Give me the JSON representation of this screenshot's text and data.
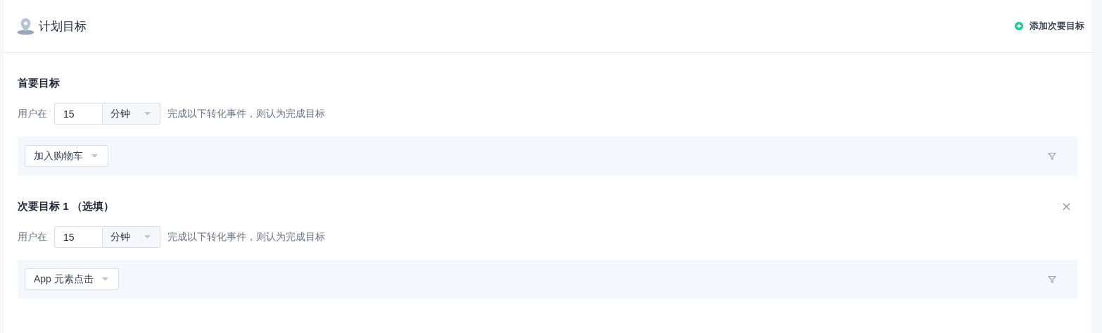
{
  "header": {
    "title": "计划目标",
    "add_button": "添加次要目标"
  },
  "goals": [
    {
      "title": "首要目标",
      "removable": false,
      "prefix": "用户在",
      "value": "15",
      "unit": "分钟",
      "suffix": "完成以下转化事件，则认为完成目标",
      "event": "加入购物车"
    },
    {
      "title": "次要目标 1 （选填）",
      "removable": true,
      "prefix": "用户在",
      "value": "15",
      "unit": "分钟",
      "suffix": "完成以下转化事件，则认为完成目标",
      "event": "App 元素点击"
    }
  ]
}
